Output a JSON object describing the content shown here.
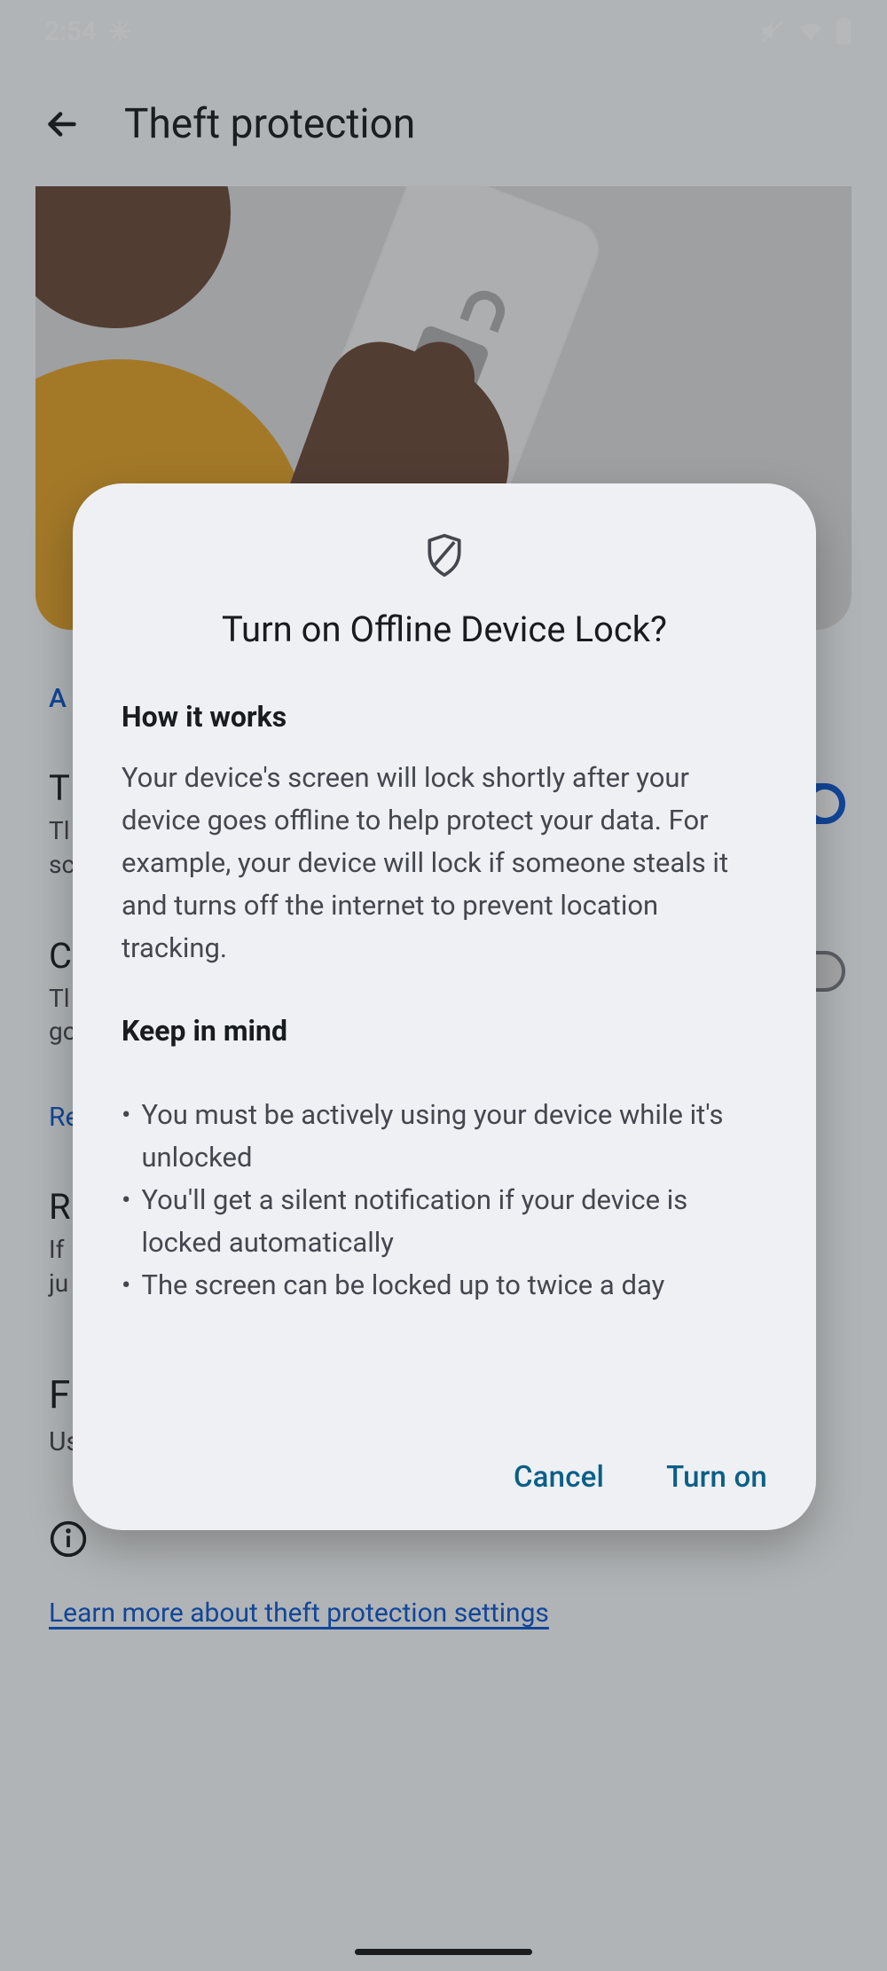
{
  "statusbar": {
    "time": "2:54"
  },
  "header": {
    "title": "Theft protection"
  },
  "background": {
    "section_label": "A",
    "item1": {
      "title": "T",
      "subtitle": "Tl\nsc"
    },
    "item2": {
      "title": "C",
      "subtitle": "Tl\ngo"
    },
    "link1": "Re",
    "item3": {
      "title": "R",
      "subtitle": "If\nju"
    },
    "section2_title": "Find & erase your device",
    "section2_sub": "Use Find My Device to locate or erase your device",
    "learn_more": "Learn more about theft protection settings"
  },
  "dialog": {
    "title": "Turn on Offline Device Lock?",
    "how_heading": "How it works",
    "how_body": "Your device's screen will lock shortly after your device goes offline to help protect your data. For example, your device will lock if someone steals it and turns off the internet to prevent location tracking.",
    "keep_heading": "Keep in mind",
    "bullets": [
      "You must be actively using your device while it's unlocked",
      "You'll get a silent notification if your device is locked automatically",
      "The screen can be locked up to twice a day"
    ],
    "cancel": "Cancel",
    "confirm": "Turn on"
  }
}
